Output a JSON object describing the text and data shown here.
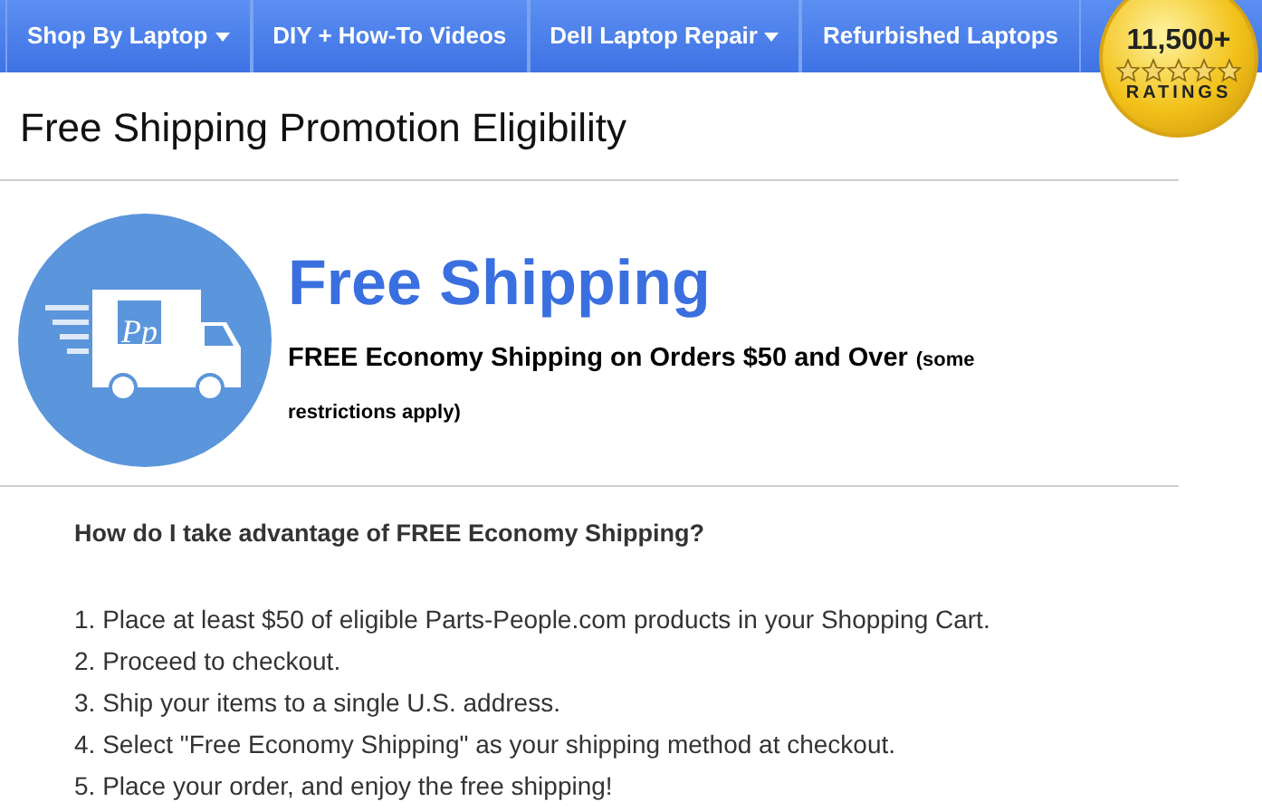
{
  "nav": [
    {
      "label": "Shop By Laptop",
      "has_menu": true
    },
    {
      "label": "DIY + How-To Videos",
      "has_menu": false
    },
    {
      "label": "Dell Laptop Repair",
      "has_menu": true
    },
    {
      "label": "Refurbished Laptops",
      "has_menu": false
    }
  ],
  "ratings_badge": {
    "count": "11,500+",
    "stars": 5,
    "label": "RATINGS"
  },
  "page_title": "Free Shipping Promotion Eligibility",
  "promo": {
    "logo_text": "Pp",
    "heading": "Free Shipping",
    "subheading": "FREE Economy Shipping on Orders $50 and Over",
    "note": "(some restrictions apply)"
  },
  "faq": {
    "question": "How do I take advantage of FREE Economy Shipping?",
    "steps": [
      "1. Place at least $50 of eligible Parts-People.com products in your Shopping Cart.",
      "2. Proceed to checkout.",
      "3. Ship your items to a single U.S. address.",
      "4. Select \"Free Economy Shipping\" as your shipping method at checkout.",
      "5. Place your order, and enjoy the free shipping!"
    ]
  }
}
